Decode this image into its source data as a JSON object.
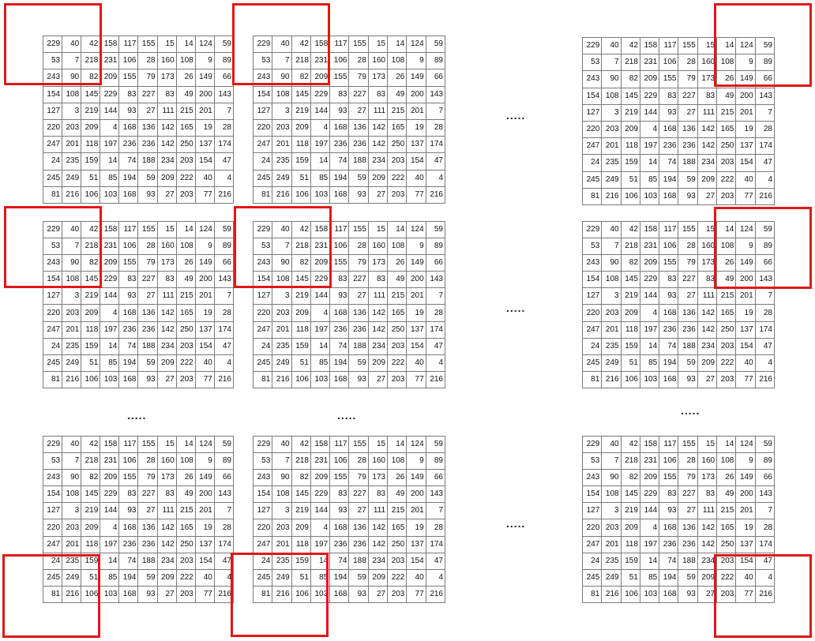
{
  "matrix": [
    [
      "229",
      "40",
      "42",
      "158",
      "117",
      "155",
      "15",
      "14",
      "124",
      "59"
    ],
    [
      "53",
      "7",
      "218",
      "231",
      "106",
      "28",
      "160",
      "108",
      "9",
      "89"
    ],
    [
      "243",
      "90",
      "82",
      "209",
      "155",
      "79",
      "173",
      "26",
      "149",
      "66"
    ],
    [
      "154",
      "108",
      "145",
      "229",
      "83",
      "227",
      "83",
      "49",
      "200",
      "143"
    ],
    [
      "127",
      "3",
      "219",
      "144",
      "93",
      "27",
      "111",
      "215",
      "201",
      "7"
    ],
    [
      "220",
      "203",
      "209",
      "4",
      "168",
      "136",
      "142",
      "165",
      "19",
      "28"
    ],
    [
      "247",
      "201",
      "118",
      "197",
      "236",
      "236",
      "142",
      "250",
      "137",
      "174"
    ],
    [
      "24",
      "235",
      "159",
      "14",
      "74",
      "188",
      "234",
      "203",
      "154",
      "47"
    ],
    [
      "245",
      "249",
      "51",
      "85",
      "194",
      "59",
      "209",
      "222",
      "40",
      "4"
    ],
    [
      "81",
      "216",
      "106",
      "103",
      "168",
      "93",
      "27",
      "203",
      "77",
      "216"
    ]
  ],
  "ellipsis": ".....",
  "colors": {
    "window_border": "#e01818",
    "grid_line": "#7a7a7a",
    "text": "#111111"
  }
}
